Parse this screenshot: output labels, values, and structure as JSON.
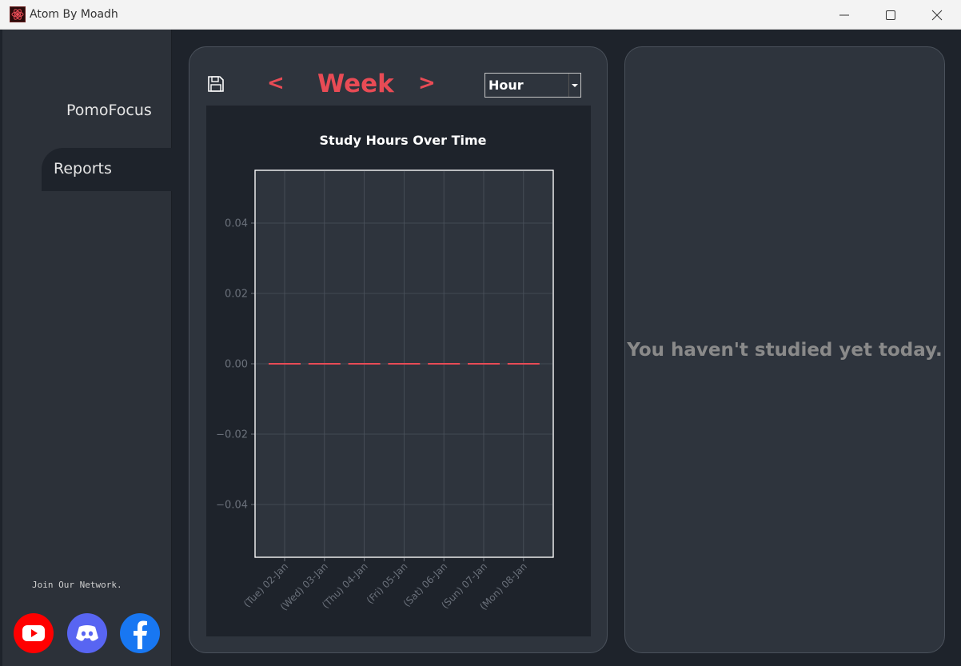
{
  "window": {
    "title": "Atom By Moadh"
  },
  "sidebar": {
    "items": [
      {
        "label": "PomoFocus"
      },
      {
        "label": "Reports"
      }
    ],
    "network_label": "Join Our Network.",
    "social": [
      "youtube-icon",
      "discord-icon",
      "facebook-icon"
    ]
  },
  "report": {
    "prev_label": "<",
    "period": "Week",
    "next_label": ">",
    "unit_value": "Hour"
  },
  "chart_data": {
    "type": "bar",
    "title": "Study Hours Over Time",
    "categories": [
      "(Tue) 02-Jan",
      "(Wed) 03-Jan",
      "(Thu) 04-Jan",
      "(Fri) 05-Jan",
      "(Sat) 06-Jan",
      "(Sun) 07-Jan",
      "(Mon) 08-Jan"
    ],
    "values": [
      0,
      0,
      0,
      0,
      0,
      0,
      0
    ],
    "yticks": [
      "0.04",
      "0.02",
      "0.00",
      "−0.02",
      "−0.04"
    ],
    "ytick_values": [
      0.04,
      0.02,
      0,
      -0.02,
      -0.04
    ],
    "ylim": [
      -0.055,
      0.055
    ],
    "grid": true,
    "bar_color": "#e84b55"
  },
  "empty_message": "You haven't studied yet today.",
  "colors": {
    "accent": "#e84b55",
    "youtube": "#ff0000",
    "discord": "#5865f2",
    "facebook": "#1877f2"
  }
}
